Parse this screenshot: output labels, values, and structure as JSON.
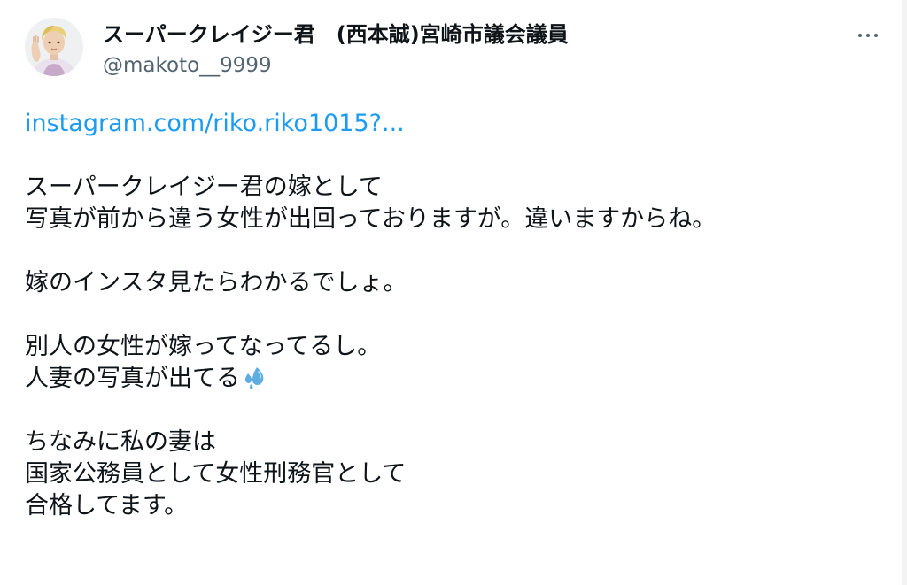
{
  "author": {
    "display_name": "スーパークレイジー君　(西本誠)宮崎市議会議員",
    "handle": "@makoto__9999"
  },
  "tweet": {
    "link": "instagram.com/riko.riko1015?...",
    "para1_line1": "スーパークレイジー君の嫁として",
    "para1_line2": "写真が前から違う女性が出回っておりますが。違いますからね。",
    "para2_line1": "嫁のインスタ見たらわかるでしょ。",
    "para3_line1": "別人の女性が嫁ってなってるし。",
    "para3_line2": "人妻の写真が出てる",
    "para4_line1": "ちなみに私の妻は",
    "para4_line2": "国家公務員として女性刑務官として",
    "para4_line3": "合格してます。"
  },
  "icons": {
    "more": "more-horizontal-icon",
    "sweat_droplets": "sweat-droplets-emoji"
  },
  "colors": {
    "link": "#1d9bf0",
    "handle": "#536471",
    "text": "#0f1419",
    "emoji": "#5dade2"
  }
}
